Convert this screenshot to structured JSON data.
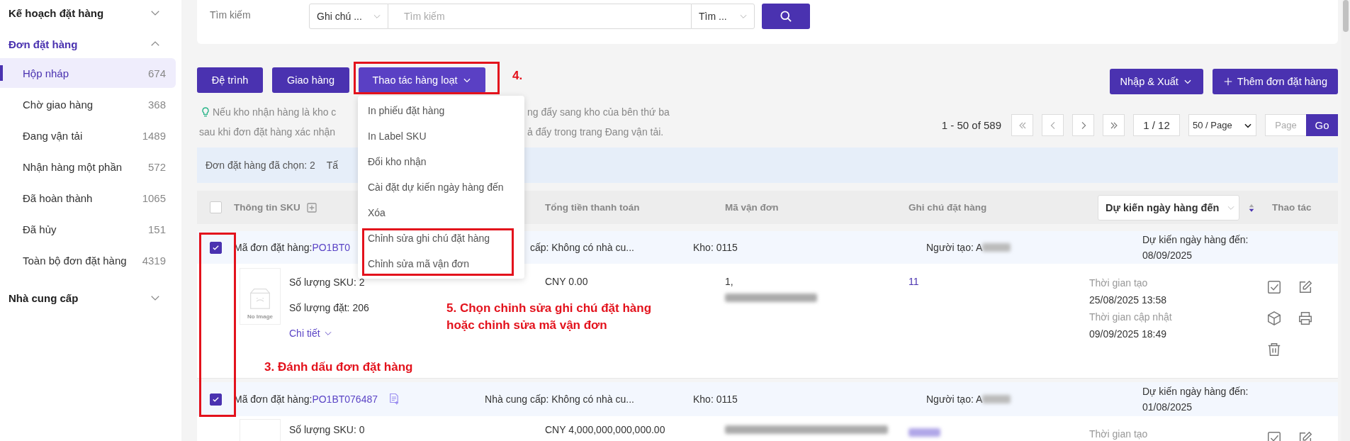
{
  "sidebar": {
    "groups": [
      {
        "label": "Kế hoạch đặt hàng",
        "active": false,
        "expanded": false
      },
      {
        "label": "Đơn đặt hàng",
        "active": true,
        "expanded": true,
        "items": [
          {
            "label": "Hộp nháp",
            "count": "674",
            "selected": true
          },
          {
            "label": "Chờ giao hàng",
            "count": "368",
            "selected": false
          },
          {
            "label": "Đang vận tải",
            "count": "1489",
            "selected": false
          },
          {
            "label": "Nhận hàng một phần",
            "count": "572",
            "selected": false
          },
          {
            "label": "Đã hoàn thành",
            "count": "1065",
            "selected": false
          },
          {
            "label": "Đã hủy",
            "count": "151",
            "selected": false
          },
          {
            "label": "Toàn bộ đơn đặt hàng",
            "count": "4319",
            "selected": false
          }
        ]
      },
      {
        "label": "Nhà cung cấp",
        "active": false,
        "expanded": false
      }
    ]
  },
  "search": {
    "label": "Tìm kiếm",
    "field_select": "Ghi chú ...",
    "placeholder": "Tìm kiếm",
    "mode_select": "Tìm ..."
  },
  "toolbar": {
    "buttons": [
      {
        "label": "Đệ trình",
        "kind": "plain"
      },
      {
        "label": "Giao hàng",
        "kind": "plain"
      },
      {
        "label": "Thao tác hàng loạt",
        "kind": "dropdown",
        "expanded": true,
        "menu": [
          "In phiếu đặt hàng",
          "In Label SKU",
          "Đổi kho nhận",
          "Cài đặt dự kiến ngày hàng đến",
          "Xóa",
          "Chỉnh sửa ghi chú đặt hàng",
          "Chỉnh sửa mã vận đơn"
        ]
      }
    ],
    "right_buttons": [
      {
        "label": "Nhập & Xuất",
        "kind": "dropdown"
      },
      {
        "label": "Thêm đơn đặt hàng",
        "kind": "add"
      }
    ]
  },
  "tip": {
    "left": [
      "Nếu kho nhận hàng là kho c",
      "sau khi đơn đặt hàng xác nhận"
    ],
    "right": [
      "ng đẩy sang kho của bên thứ ba",
      "ả đẩy trong trang Đang vận tải."
    ]
  },
  "pagination": {
    "range": "1 - 50 of 589",
    "page": "1 / 12",
    "page_size": "50 / Page",
    "page_placeholder": "Page",
    "go": "Go"
  },
  "selection_bar": {
    "count_text": "Đơn đặt hàng đã chọn: 2",
    "text_2": "Tấ"
  },
  "table": {
    "header_checked": false,
    "columns": [
      {
        "label": "Thông tin SKU",
        "kind": "expandable"
      },
      {
        "label": "Tổng tiền thanh toán",
        "kind": "text"
      },
      {
        "label": "Mã vận đơn",
        "kind": "text"
      },
      {
        "label": "Ghi chú đặt hàng",
        "kind": "text"
      },
      {
        "label": "Dự kiến ngày hàng đến",
        "kind": "sort_select"
      },
      {
        "label": "Thao tác",
        "kind": "text"
      }
    ],
    "orders": [
      {
        "checked": true,
        "order_label": "Mã đơn đặt hàng:",
        "order_id": "PO1BT0",
        "note_icon": false,
        "supplier": "cấp: Không có nhà cu...",
        "warehouse": "Kho: 0115",
        "creator": "Người tạo: A",
        "creator_blurred": true,
        "eta_label": "Dự kiến ngày hàng đến:",
        "eta": "08/09/2025",
        "thumb_text": "No Image",
        "sku_count": "Số lượng SKU: 2",
        "qty": "Số lượng đặt: 206",
        "detail": "Chi tiết",
        "total": "CNY 0.00",
        "tracking": "1,",
        "tracking_blurred": true,
        "note": "11",
        "note_blurred": false,
        "created_label": "Thời gian tạo",
        "created": "25/08/2025 13:58",
        "updated_label": "Thời gian cập nhật",
        "updated": "09/09/2025 18:49"
      },
      {
        "checked": true,
        "order_label": "Mã đơn đặt hàng:",
        "order_id": "PO1BT076487",
        "note_icon": true,
        "supplier": "Nhà cung cấp: Không có nhà cu...",
        "warehouse": "Kho: 0115",
        "creator": "Người tạo: A",
        "creator_blurred": true,
        "eta_label": "Dự kiến ngày hàng đến:",
        "eta": "01/08/2025",
        "sku_count": "Số lượng SKU: 0",
        "total": "CNY 4,000,000,000,000.00",
        "tracking_blurred": true,
        "note_blurred": true,
        "created_label": "Thời gian tạo"
      }
    ]
  },
  "annotations": [
    {
      "kind": "frame"
    },
    {
      "kind": "frame"
    },
    {
      "kind": "frame"
    },
    {
      "kind": "label",
      "text": "4."
    },
    {
      "kind": "label",
      "text": "5. Chọn chỉnh sửa ghi chú đặt hàng\nhoặc chỉnh sửa mã vận đơn"
    },
    {
      "kind": "label",
      "text": "3. Đánh dấu đơn đặt hàng"
    }
  ]
}
